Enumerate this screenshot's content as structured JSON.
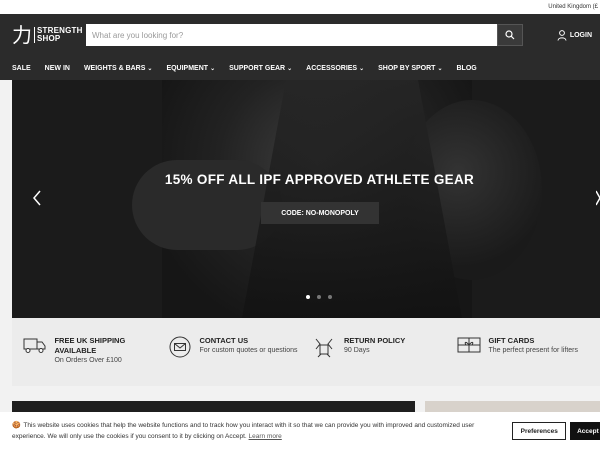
{
  "topbar": {
    "region": "United Kingdom (£"
  },
  "brand": {
    "mark": "力",
    "line1": "STRENGTH",
    "line2": "SHOP"
  },
  "search": {
    "placeholder": "What are you looking for?"
  },
  "login": {
    "label": "LOGIN"
  },
  "nav": [
    {
      "label": "SALE",
      "dropdown": false
    },
    {
      "label": "NEW IN",
      "dropdown": false
    },
    {
      "label": "WEIGHTS & BARS",
      "dropdown": true
    },
    {
      "label": "EQUIPMENT",
      "dropdown": true
    },
    {
      "label": "SUPPORT GEAR",
      "dropdown": true
    },
    {
      "label": "ACCESSORIES",
      "dropdown": true
    },
    {
      "label": "SHOP BY SPORT",
      "dropdown": true
    },
    {
      "label": "BLOG",
      "dropdown": false
    }
  ],
  "hero": {
    "title": "15% OFF ALL IPF APPROVED ATHLETE GEAR",
    "code_label": "CODE: NO-MONOPOLY",
    "active_slide": 1,
    "slide_count": 3
  },
  "features": [
    {
      "icon": "truck-icon",
      "title": "FREE UK SHIPPING AVAILABLE",
      "sub": "On Orders Over £100"
    },
    {
      "icon": "mail-icon",
      "title": "CONTACT US",
      "sub": "For custom quotes or questions"
    },
    {
      "icon": "return-icon",
      "title": "RETURN POLICY",
      "sub": "90 Days"
    },
    {
      "icon": "gift-icon",
      "title": "GIFT CARDS",
      "sub": "The perfect present for lifters"
    }
  ],
  "cookie": {
    "icon": "cookie-icon",
    "text": "This website uses cookies that help the website functions and to track how you interact with it so that we can provide you with improved and customized user experience. We will only use the cookies if you consent to it by clicking on Accept.",
    "link": "Learn more",
    "preferences_label": "Preferences",
    "accept_label": "Accept"
  },
  "colors": {
    "header_bg": "#2b2b2b",
    "hero_bg": "#1b1b1b",
    "features_bg": "#ececec"
  }
}
